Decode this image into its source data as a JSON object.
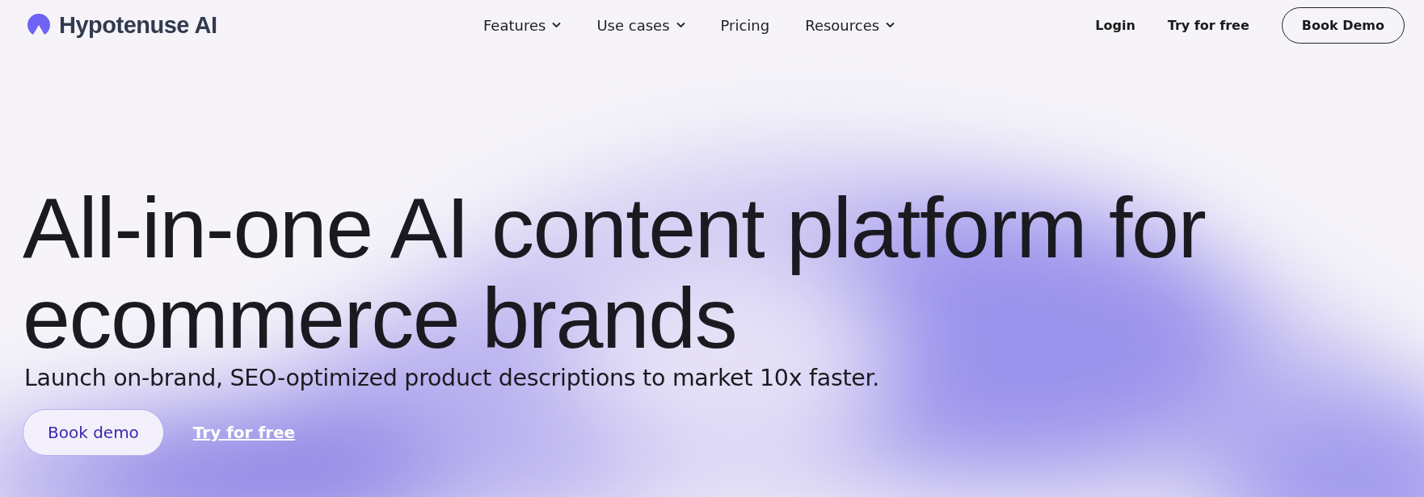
{
  "header": {
    "brand": "Hypotenuse AI",
    "nav": [
      {
        "label": "Features",
        "dropdown": true
      },
      {
        "label": "Use cases",
        "dropdown": true
      },
      {
        "label": "Pricing",
        "dropdown": false
      },
      {
        "label": "Resources",
        "dropdown": true
      }
    ],
    "login": "Login",
    "try_free": "Try for free",
    "book_demo": "Book Demo"
  },
  "hero": {
    "headline": "All-in-one AI content platform for ecommerce brands",
    "subtitle": "Launch on-brand, SEO-optimized product descriptions to market 10x faster.",
    "book_demo": "Book demo",
    "try_free": "Try for free"
  }
}
